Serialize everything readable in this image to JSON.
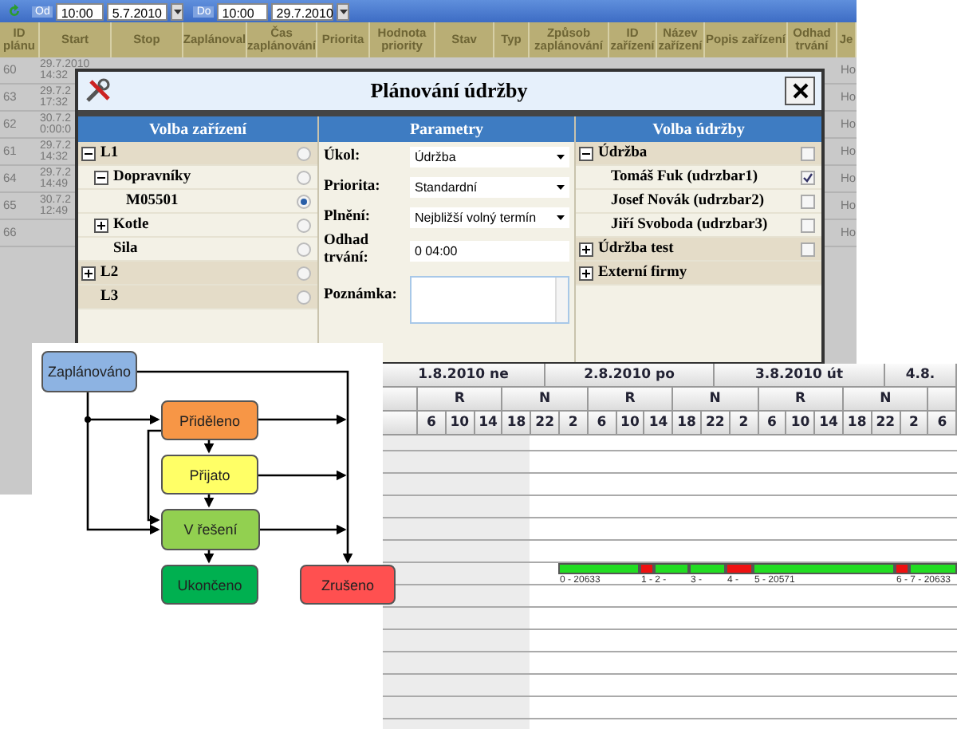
{
  "toolbar": {
    "from_label": "Od",
    "from_time": "10:00",
    "from_date": "5.7.2010",
    "to_label": "Do",
    "to_time": "10:00",
    "to_date": "29.7.2010"
  },
  "table": {
    "columns": [
      "ID plánu",
      "Start",
      "Stop",
      "Zaplánoval",
      "Čas zaplánování",
      "Priorita",
      "Hodnota priority",
      "Stav",
      "Typ",
      "Způsob zaplánování",
      "ID zařízení",
      "Název zařízení",
      "Popis zařízení",
      "Odhad trvání",
      "Je"
    ],
    "rows": [
      {
        "id": "60",
        "start": "29.7.2010\n14:32",
        "column_15": "Ho"
      },
      {
        "id": "63",
        "start": "29.7.2\n17:32",
        "column_15": "Ho"
      },
      {
        "id": "62",
        "start": "30.7.2\n0:00:0",
        "column_15": "Ho"
      },
      {
        "id": "61",
        "start": "29.7.2\n14:32",
        "column_15": "Ho"
      },
      {
        "id": "64",
        "start": "29.7.2\n14:49",
        "column_15": "Ho"
      },
      {
        "id": "65",
        "start": "30.7.2\n12:49",
        "column_15": "Ho"
      },
      {
        "id": "66",
        "column_15": "Ho"
      }
    ]
  },
  "dialog": {
    "title": "Plánování údržby",
    "equipment": {
      "heading": "Volba zařízení",
      "items": [
        {
          "label": "L1",
          "expanded": true,
          "selected": false,
          "children": [
            {
              "label": "Dopravníky",
              "expanded": true,
              "selected": false,
              "children": [
                {
                  "label": "M05501",
                  "selected": true
                }
              ]
            },
            {
              "label": "Kotle",
              "expanded": false,
              "selected": false
            },
            {
              "label": "Sila",
              "selected": false
            }
          ]
        },
        {
          "label": "L2",
          "expanded": false,
          "selected": false
        },
        {
          "label": "L3",
          "selected": false
        }
      ]
    },
    "parameters": {
      "heading": "Parametry",
      "fields": [
        {
          "kind": "select",
          "label": "Úkol:",
          "value": "Údržba"
        },
        {
          "kind": "select",
          "label": "Priorita:",
          "value": "Standardní"
        },
        {
          "kind": "select",
          "label": "Plnění:",
          "value": "Nejbližší volný termín"
        },
        {
          "kind": "text",
          "label": "Odhad trvání:",
          "value": "0 04:00"
        },
        {
          "kind": "textarea",
          "label": "Poznámka:"
        }
      ]
    },
    "maintenance": {
      "heading": "Volba údržby",
      "items": [
        {
          "label": "Údržba",
          "expanded": true,
          "checked": false,
          "children": [
            {
              "label": "Tomáš Fuk (udrzbar1)",
              "checked": true
            },
            {
              "label": "Josef Novák (udrzbar2)",
              "checked": false
            },
            {
              "label": "Jiří Svoboda (udrzbar3)",
              "checked": false
            }
          ]
        },
        {
          "label": "Údržba test",
          "expanded": false,
          "checked": false
        },
        {
          "label": "Externí firmy",
          "expanded": false
        }
      ]
    }
  },
  "gantt": {
    "days": [
      "1.8.2010 ne",
      "2.8.2010 po",
      "3.8.2010 út",
      "4.8."
    ],
    "shifts": [
      "R",
      "N",
      "R",
      "N",
      "R",
      "N"
    ],
    "hours": [
      "6",
      "10",
      "14",
      "18",
      "22",
      "2",
      "6",
      "10",
      "14",
      "18",
      "22",
      "2",
      "6",
      "10",
      "14",
      "18",
      "22",
      "2",
      "6"
    ],
    "segments": [
      {
        "label": "0 - 20633",
        "color": "#22dd22"
      },
      {
        "label": "1 - 2 -",
        "color": "#ee1111"
      },
      {
        "color": "#22dd22"
      },
      {
        "label": "3 -",
        "color": "#22dd22"
      },
      {
        "label": "4 -",
        "color": "#ee1111"
      },
      {
        "label": "5 - 20571",
        "color": "#22dd22"
      },
      {
        "label": "6 - 7 - 20633",
        "color": "#ee1111"
      },
      {
        "color": "#22dd22"
      }
    ]
  },
  "diagram": {
    "nodes": [
      {
        "label": "Zaplánováno",
        "color": "#8db3e2"
      },
      {
        "label": "Přiděleno",
        "color": "#f79646"
      },
      {
        "label": "Přijato",
        "color": "#ffff66"
      },
      {
        "label": "V řešení",
        "color": "#92d050"
      },
      {
        "label": "Ukončeno",
        "color": "#00b050"
      },
      {
        "label": "Zrušeno",
        "color": "#ff5050"
      }
    ]
  }
}
